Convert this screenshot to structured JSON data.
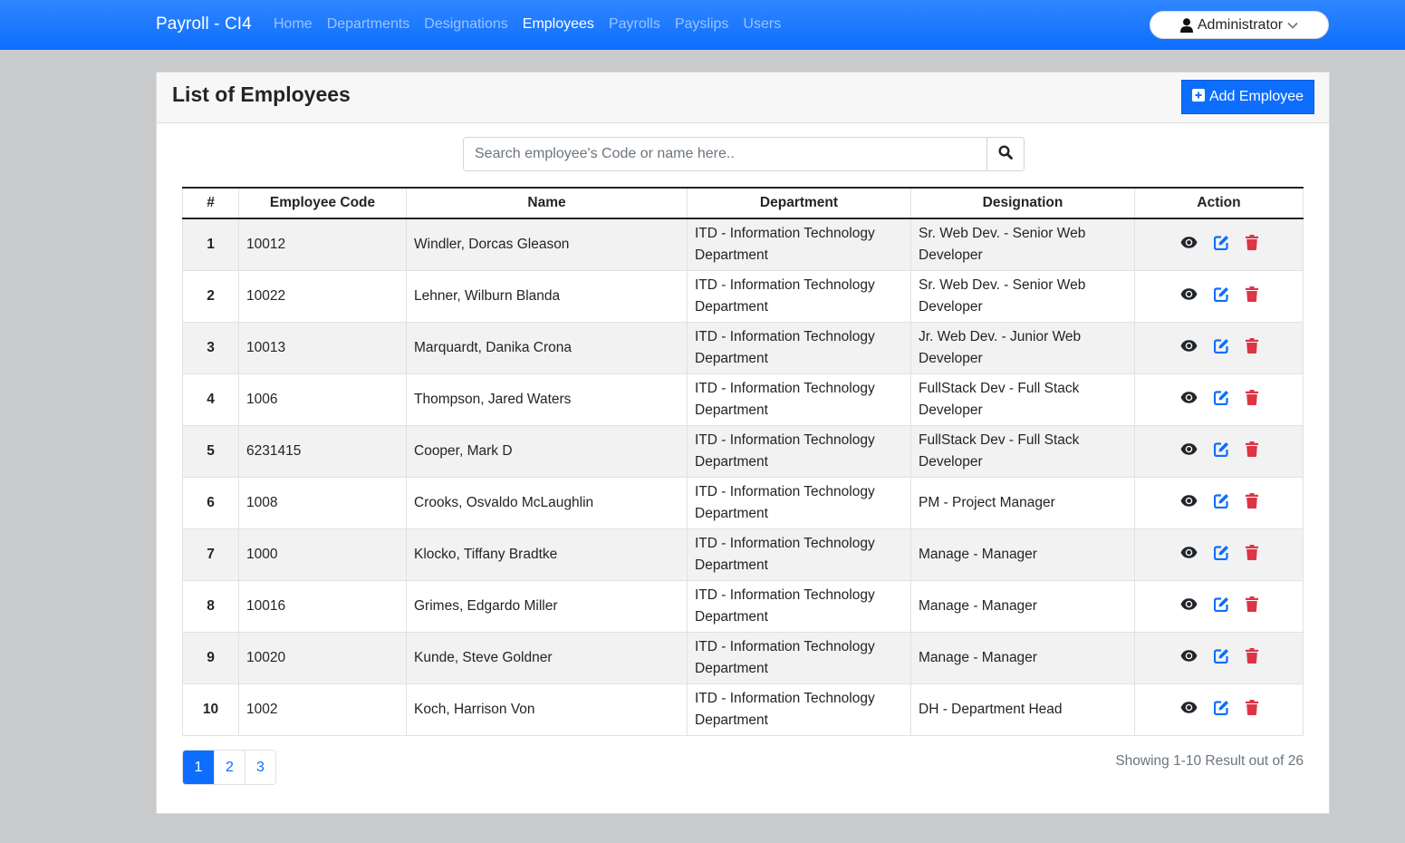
{
  "navbar": {
    "brand": "Payroll - CI4",
    "links": [
      {
        "label": "Home",
        "active": false
      },
      {
        "label": "Departments",
        "active": false
      },
      {
        "label": "Designations",
        "active": false
      },
      {
        "label": "Employees",
        "active": true
      },
      {
        "label": "Payrolls",
        "active": false
      },
      {
        "label": "Payslips",
        "active": false
      },
      {
        "label": "Users",
        "active": false
      }
    ],
    "user_menu": {
      "label": "Administrator",
      "icon": "user-icon",
      "caret": "chevron-down-icon"
    }
  },
  "card": {
    "title": "List of Employees",
    "add_button": {
      "label": "Add Employee",
      "icon": "plus-square-icon"
    }
  },
  "search": {
    "placeholder": "Search employee's Code or name here..",
    "value": "",
    "button_icon": "search-icon"
  },
  "table": {
    "headers": [
      "#",
      "Employee Code",
      "Name",
      "Department",
      "Designation",
      "Action"
    ],
    "rows": [
      {
        "num": "1",
        "code": "10012",
        "name": "Windler, Dorcas Gleason",
        "department": "ITD - Information Technology Department",
        "designation": "Sr. Web Dev. - Senior Web Developer"
      },
      {
        "num": "2",
        "code": "10022",
        "name": "Lehner, Wilburn Blanda",
        "department": "ITD - Information Technology Department",
        "designation": "Sr. Web Dev. - Senior Web Developer"
      },
      {
        "num": "3",
        "code": "10013",
        "name": "Marquardt, Danika Crona",
        "department": "ITD - Information Technology Department",
        "designation": "Jr. Web Dev. - Junior Web Developer"
      },
      {
        "num": "4",
        "code": "1006",
        "name": "Thompson, Jared Waters",
        "department": "ITD - Information Technology Department",
        "designation": "FullStack Dev - Full Stack Developer"
      },
      {
        "num": "5",
        "code": "6231415",
        "name": "Cooper, Mark D",
        "department": "ITD - Information Technology Department",
        "designation": "FullStack Dev - Full Stack Developer"
      },
      {
        "num": "6",
        "code": "1008",
        "name": "Crooks, Osvaldo McLaughlin",
        "department": "ITD - Information Technology Department",
        "designation": "PM - Project Manager"
      },
      {
        "num": "7",
        "code": "1000",
        "name": "Klocko, Tiffany Bradtke",
        "department": "ITD - Information Technology Department",
        "designation": "Manage - Manager"
      },
      {
        "num": "8",
        "code": "10016",
        "name": "Grimes, Edgardo Miller",
        "department": "ITD - Information Technology Department",
        "designation": "Manage - Manager"
      },
      {
        "num": "9",
        "code": "10020",
        "name": "Kunde, Steve Goldner",
        "department": "ITD - Information Technology Department",
        "designation": "Manage - Manager"
      },
      {
        "num": "10",
        "code": "1002",
        "name": "Koch, Harrison Von",
        "department": "ITD - Information Technology Department",
        "designation": "DH - Department Head"
      }
    ],
    "actions": [
      {
        "name": "view",
        "icon": "eye-icon",
        "color": "#212529"
      },
      {
        "name": "edit",
        "icon": "edit-icon",
        "color": "#0d6efd"
      },
      {
        "name": "delete",
        "icon": "trash-icon",
        "color": "#dc3545"
      }
    ]
  },
  "pagination": {
    "pages": [
      "1",
      "2",
      "3"
    ],
    "current": "1",
    "result_info": "Showing 1-10 Result out of 26"
  },
  "colors": {
    "primary": "#0d6efd",
    "danger": "#dc3545",
    "page_bg": "#c9cacb"
  }
}
